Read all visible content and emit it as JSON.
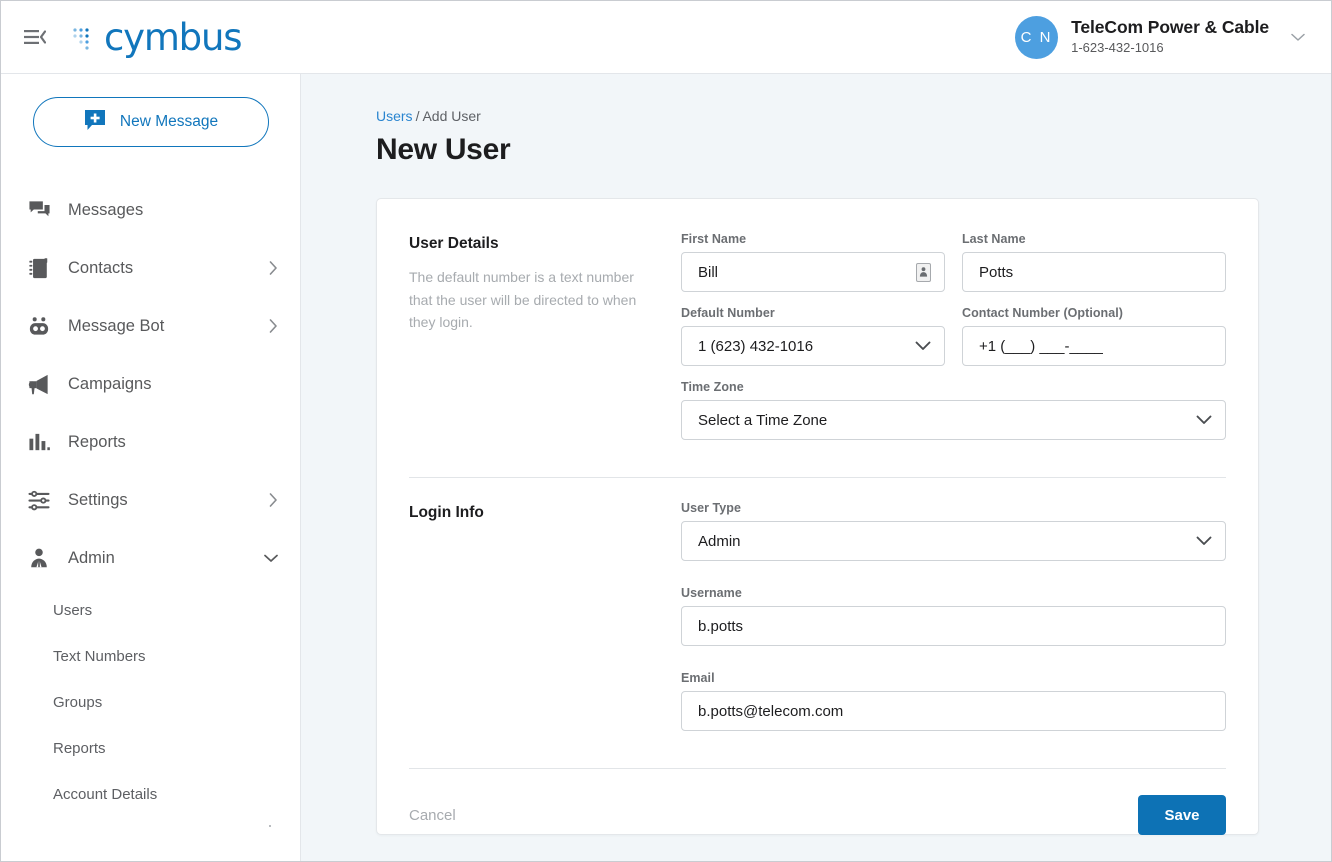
{
  "topbar": {
    "menu_icon": "menu-collapse-icon",
    "brand": "cymbus",
    "account": {
      "avatar_initials": "C N",
      "name": "TeleCom Power & Cable",
      "phone": "1-623-432-1016",
      "caret_icon": "chevron-down-icon"
    }
  },
  "sidebar": {
    "new_message_label": "New Message",
    "new_message_icon": "new-message-bubble-icon",
    "items": [
      {
        "label": "Messages",
        "icon": "messages-icon",
        "expandable": false
      },
      {
        "label": "Contacts",
        "icon": "contacts-icon",
        "expandable": true
      },
      {
        "label": "Message Bot",
        "icon": "message-bot-icon",
        "expandable": true
      },
      {
        "label": "Campaigns",
        "icon": "campaigns-icon",
        "expandable": false
      },
      {
        "label": "Reports",
        "icon": "reports-icon",
        "expandable": false
      },
      {
        "label": "Settings",
        "icon": "settings-icon",
        "expandable": true
      },
      {
        "label": "Admin",
        "icon": "admin-icon",
        "expandable": true,
        "expanded": true
      }
    ],
    "admin_subitems": [
      {
        "label": "Users"
      },
      {
        "label": "Text Numbers"
      },
      {
        "label": "Groups"
      },
      {
        "label": "Reports"
      },
      {
        "label": "Account Details"
      }
    ]
  },
  "main": {
    "breadcrumb": {
      "root": "Users",
      "separator": "/",
      "current": "Add User"
    },
    "page_title": "New User",
    "user_details": {
      "title": "User Details",
      "description": "The default number is a text number that the user will be directed to when they login.",
      "first_name": {
        "label": "First Name",
        "value": "Bill",
        "autofill_icon": "contact-card-icon"
      },
      "last_name": {
        "label": "Last Name",
        "value": "Potts"
      },
      "default_number": {
        "label": "Default Number",
        "value": "1 (623) 432-1016",
        "caret_icon": "chevron-down-icon"
      },
      "contact_number": {
        "label": "Contact Number (Optional)",
        "value": "",
        "placeholder": "+1 (___) ___-____"
      },
      "time_zone": {
        "label": "Time Zone",
        "value": "Select a Time Zone",
        "caret_icon": "chevron-down-icon"
      }
    },
    "login_info": {
      "title": "Login Info",
      "user_type": {
        "label": "User Type",
        "value": "Admin",
        "caret_icon": "chevron-down-icon"
      },
      "username": {
        "label": "Username",
        "value": "b.potts"
      },
      "email": {
        "label": "Email",
        "value": "b.potts@telecom.com"
      }
    },
    "actions": {
      "cancel_label": "Cancel",
      "save_label": "Save"
    }
  },
  "colors": {
    "brand_blue": "#1176bc",
    "link_blue": "#2a85d0",
    "save_blue": "#0d72b5",
    "avatar_blue": "#4d9fe0",
    "page_bg": "#f2f6f9"
  }
}
